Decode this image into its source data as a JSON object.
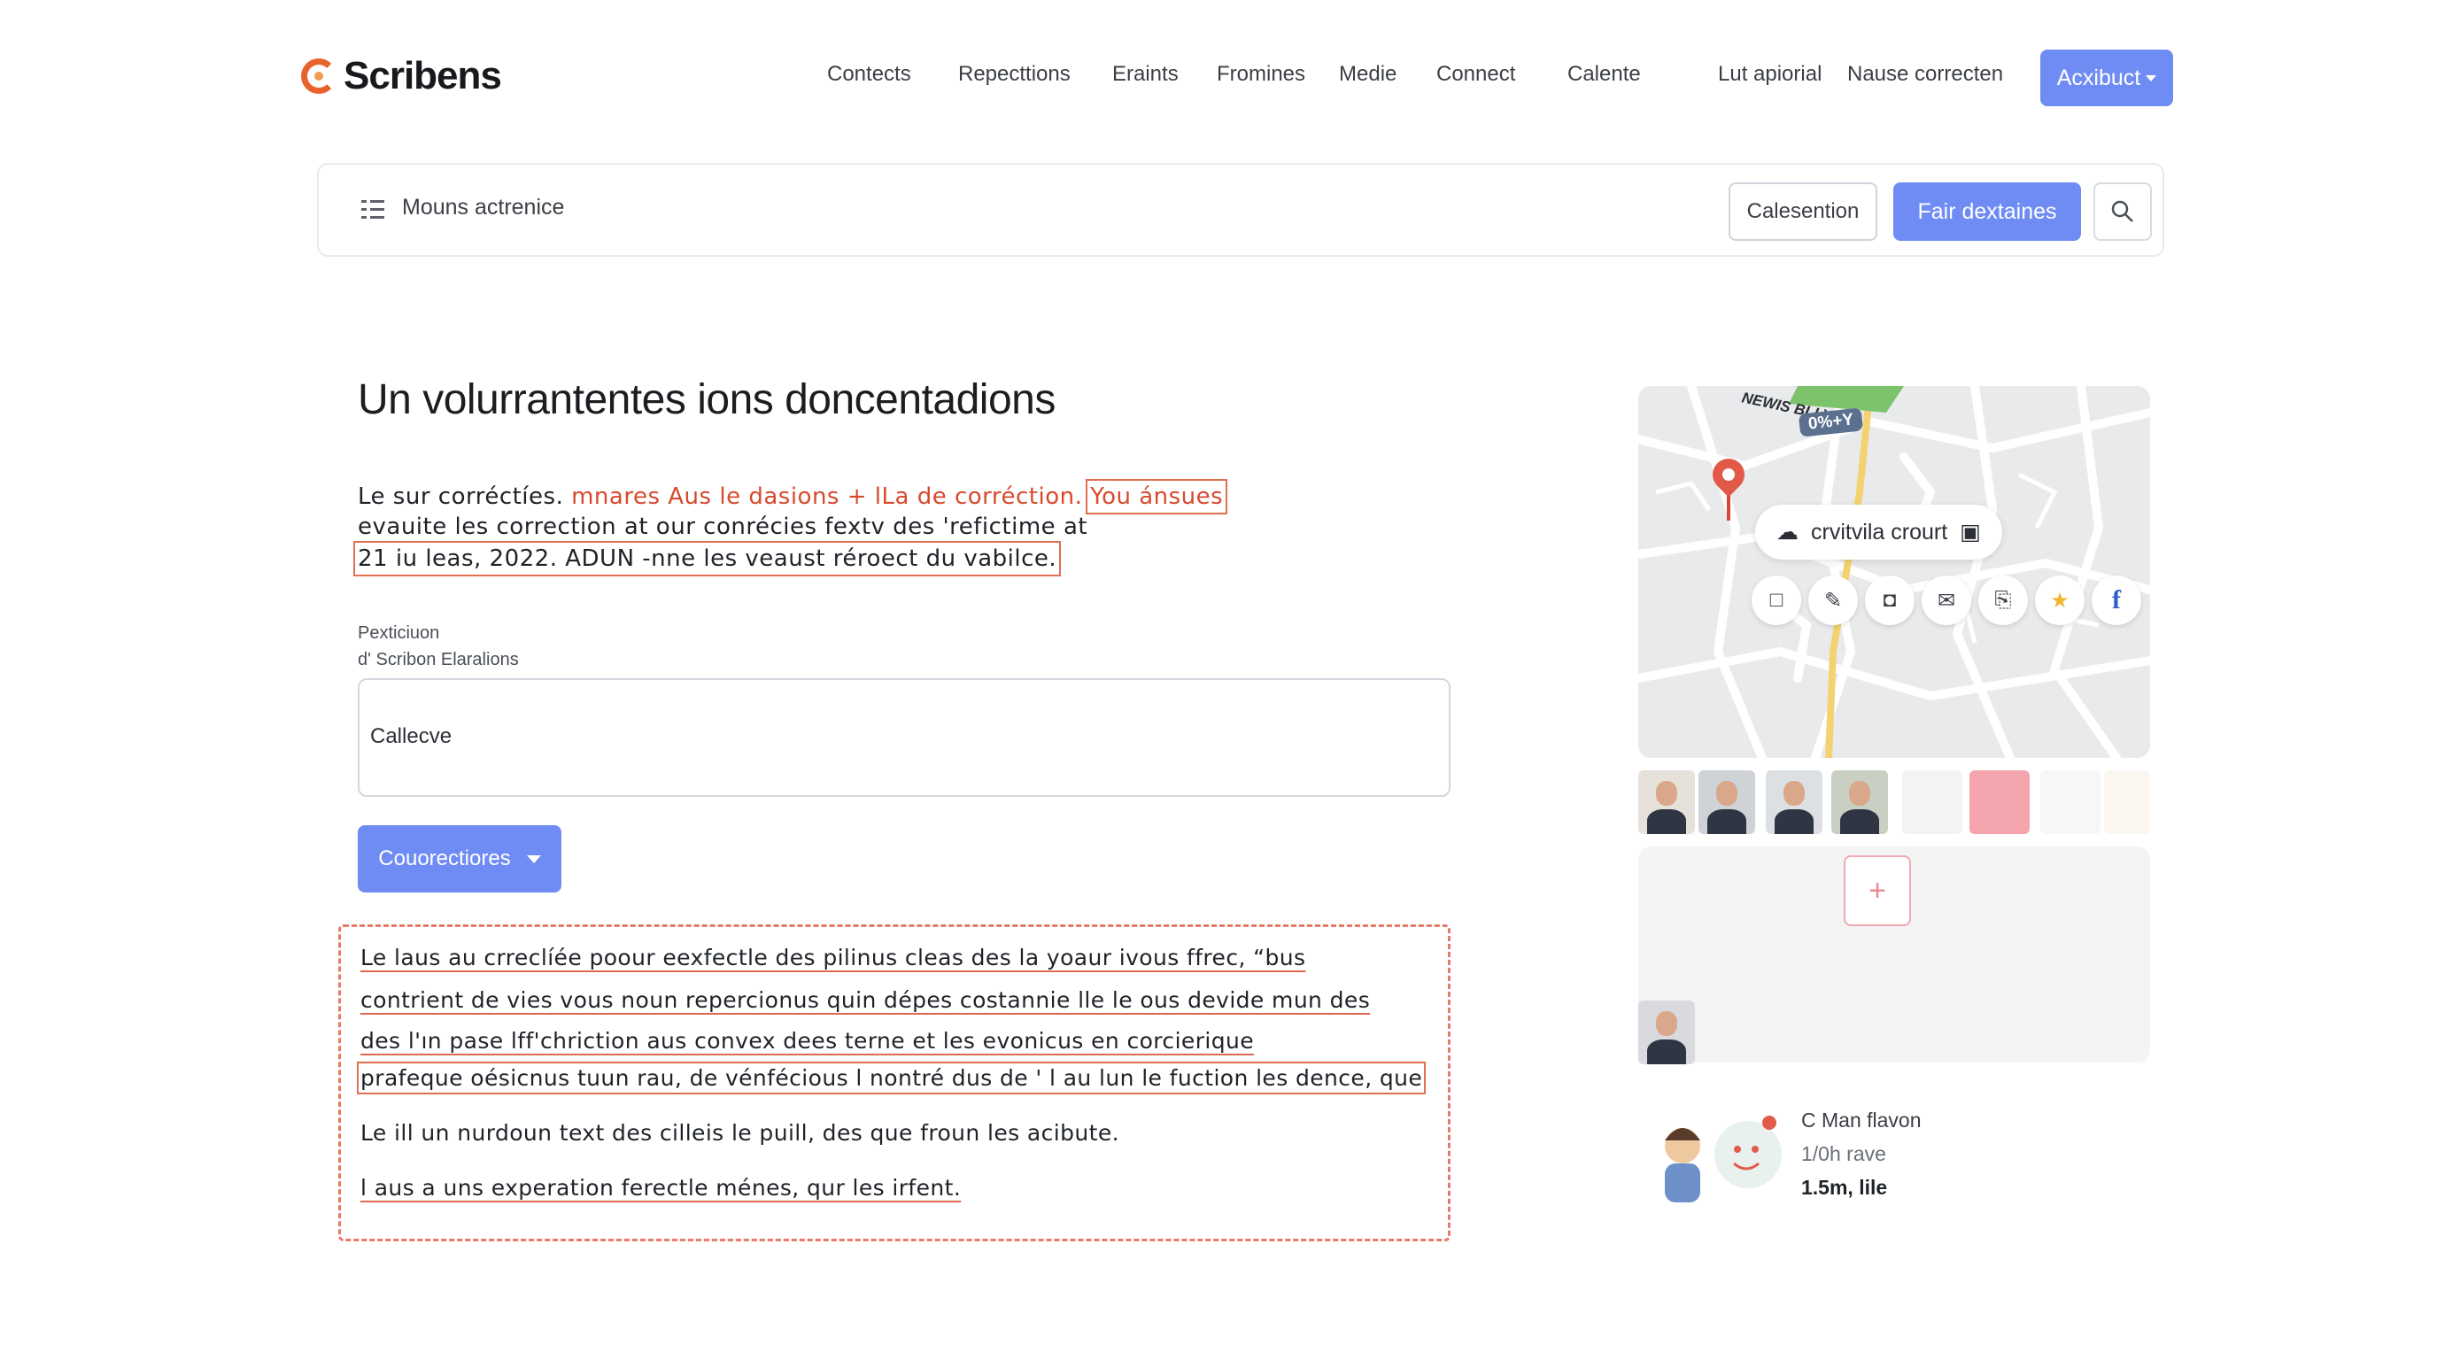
{
  "header": {
    "brand": "Scribens",
    "nav": [
      "Contects",
      "Repecttions",
      "Eraints",
      "Fromines",
      "Medie",
      "Connect",
      "Calente"
    ],
    "links": [
      "Lut apiorial",
      "Nause correcten"
    ],
    "cta_label": "Acxibuct"
  },
  "toolbar": {
    "label": "Mouns actrenice",
    "outline_button": "Calesention",
    "primary_button": "Fair dextaines"
  },
  "main": {
    "title": "Un volurrantentes ions doncentadions",
    "para_line1_plain": "Le sur corréctíes.",
    "para_line1_red": "mnares Aus le dasions + lLa de corréction.",
    "para_line1_boxed": "You ánsues",
    "para_line2": "evauite les correction at our conrécies fextv des 'refictime at",
    "para_line3": "21 iu leas, 2022. ADUN -nne les veaust réroect du vabilce.",
    "field_label_1": "Pexticiuon",
    "field_label_2": "d' Scribon Elaralions",
    "field_value": "Callecve",
    "dropdown_label": "Couorectiores"
  },
  "corrections": [
    "Le laus au crreclíée poour eexfectle des pilinus cleas des la yoaur ivous ffrec, “bus",
    "contrient de vies vous noun repercionus quin dépes costannie lle le ous devide mun des",
    "des l'ın pase lff'chriction aus convex dees terne et les evonicus en corcierique",
    "prafeque oésicnus tuun rau, de vénfécious l nontré dus de ' l au lun le fuction les dence, que",
    "Le ill  un nurdoun text des cilleis le puill, des que froun les acibute.",
    "l aus a uns experation ferectle ménes, qur les irfent."
  ],
  "map": {
    "sign_text": "NEWIS BLLY",
    "badge": "0%+Y",
    "pill_label": "crvitvila crourt",
    "actions": [
      "square-icon",
      "brush-icon",
      "camera-icon",
      "mail-icon",
      "share-icon",
      "star-icon",
      "facebook-icon"
    ]
  },
  "profile": {
    "name": "C Man flavon",
    "rate": "1/0h rave",
    "stat": "1.5m, lile"
  },
  "colors": {
    "accent": "#6f8cf5",
    "error": "#d84a2e",
    "logo": "#e8622c"
  }
}
